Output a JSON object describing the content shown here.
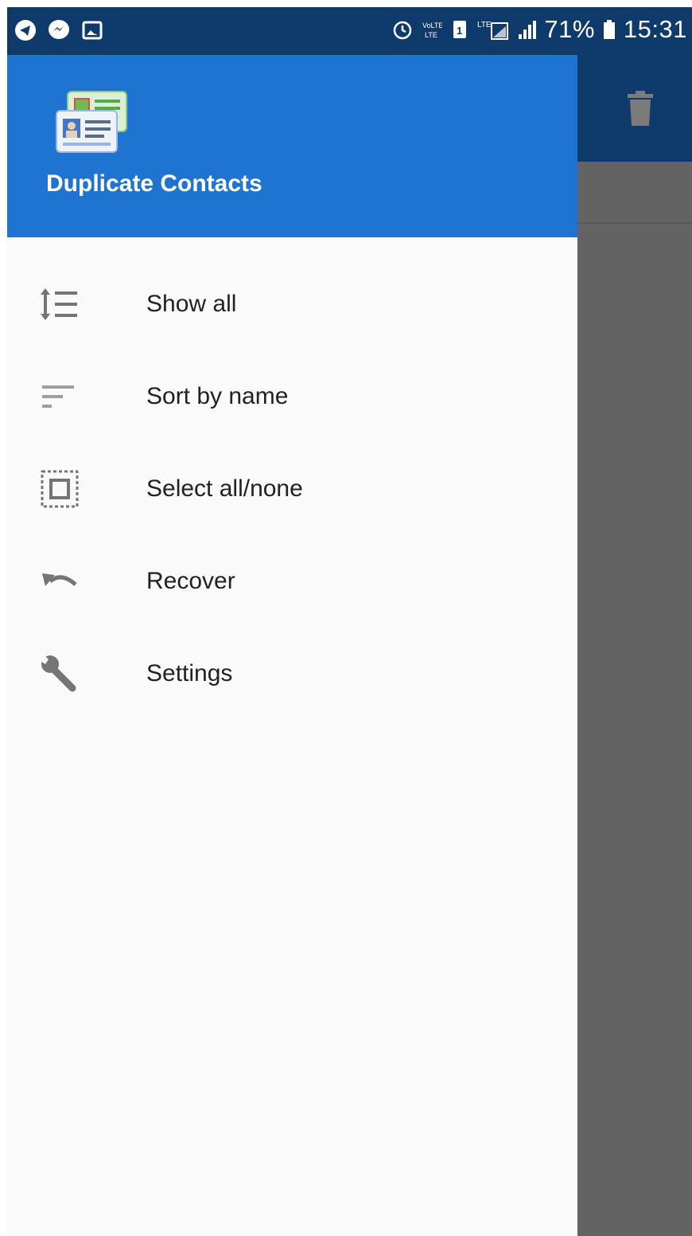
{
  "status_bar": {
    "left_icons": [
      "telegram-icon",
      "messenger-icon",
      "gallery-icon"
    ],
    "right_icons": [
      "alarm-icon",
      "volte-icon",
      "sim-icon",
      "lte-signal-icon",
      "signal-icon"
    ],
    "battery_percent": "71%",
    "time": "15:31"
  },
  "app_bar": {
    "action_icon": "trash-icon"
  },
  "drawer": {
    "app_title": "Duplicate Contacts",
    "logo_icon": "contact-cards-icon",
    "items": [
      {
        "label": "Show all",
        "icon": "line-spacing-icon"
      },
      {
        "label": "Sort by name",
        "icon": "sort-icon"
      },
      {
        "label": "Select all/none",
        "icon": "select-all-icon"
      },
      {
        "label": "Recover",
        "icon": "undo-icon"
      },
      {
        "label": "Settings",
        "icon": "wrench-icon"
      }
    ]
  },
  "colors": {
    "status_bar": "#0e3b6b",
    "drawer_header": "#1e74d0",
    "drawer_bg": "#fafafa",
    "scrim": "#636363",
    "icon_gray": "#757575"
  }
}
